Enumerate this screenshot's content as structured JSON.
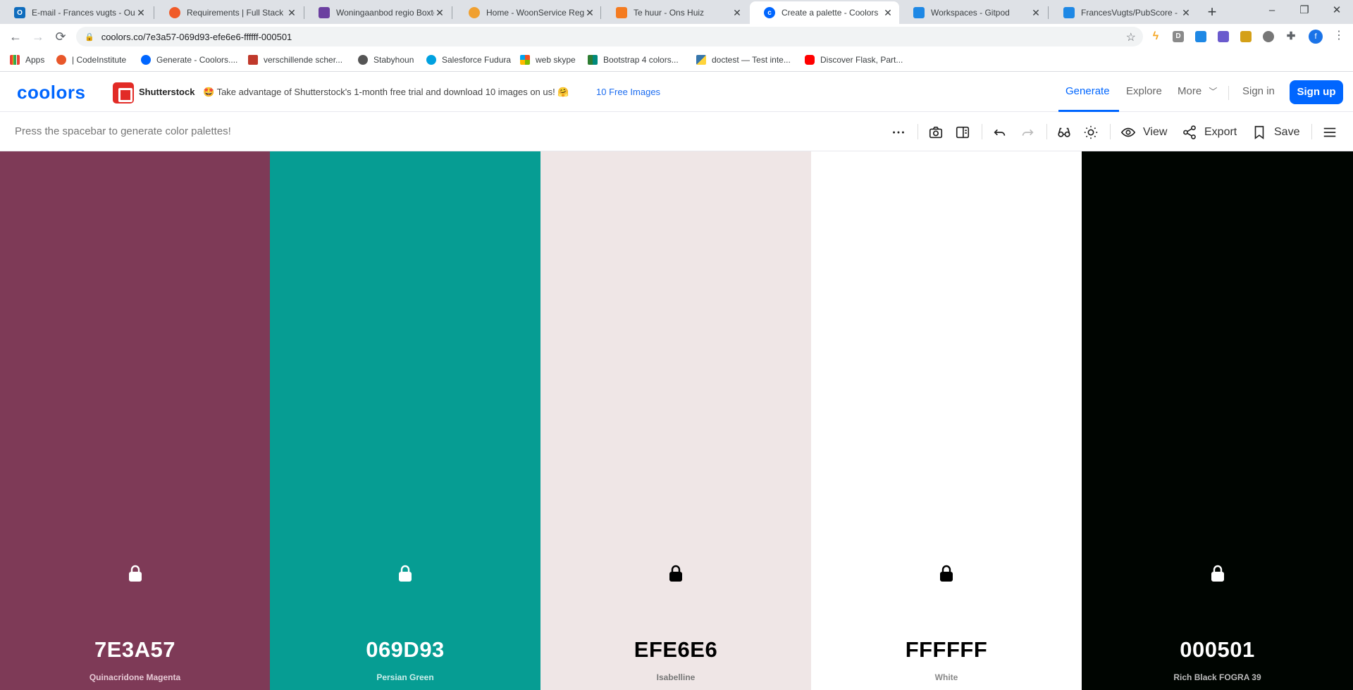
{
  "browser": {
    "tabs": [
      {
        "title": "E-mail - Frances vugts - Outl",
        "icon_color": "#0f6cbd",
        "active": false
      },
      {
        "title": "Requirements | Full Stack Fr",
        "icon_color": "#f05a28",
        "active": false
      },
      {
        "title": "Woningaanbod regio Boxte",
        "icon_color": "#6b3fa0",
        "active": false
      },
      {
        "title": "Home - WoonService Regio",
        "icon_color": "#f0a030",
        "active": false
      },
      {
        "title": "Te huur - Ons Huiz",
        "icon_color": "#f47b20",
        "active": false
      },
      {
        "title": "Create a palette - Coolors",
        "icon_color": "#0066ff",
        "active": true
      },
      {
        "title": "Workspaces - Gitpod",
        "icon_color": "#1e88e5",
        "active": false
      },
      {
        "title": "FrancesVugts/PubScore - m",
        "icon_color": "#1e88e5",
        "active": false
      }
    ],
    "url": "coolors.co/7e3a57-069d93-efe6e6-ffffff-000501",
    "profile_initial": "f",
    "bookmarks": [
      {
        "label": "Apps",
        "icon_color": "#ea4335"
      },
      {
        "label": "| CodeInstitute",
        "icon_color": "#e8572a"
      },
      {
        "label": "Generate - Coolors....",
        "icon_color": "#0066ff"
      },
      {
        "label": "verschillende scher...",
        "icon_color": "#c0392b"
      },
      {
        "label": "Stabyhoun",
        "icon_color": "#555555"
      },
      {
        "label": "Salesforce Fudura",
        "icon_color": "#00a1e0"
      },
      {
        "label": "web skype",
        "icon_color": "#f25022"
      },
      {
        "label": "Bootstrap 4 colors...",
        "icon_color": "#2e7d32"
      },
      {
        "label": "doctest — Test inte...",
        "icon_color": "#3776ab"
      },
      {
        "label": "Discover Flask, Part...",
        "icon_color": "#ff0000"
      }
    ]
  },
  "header": {
    "logo": "coolors",
    "sponsor_name": "Shutterstock",
    "promo_text": "Take advantage of Shutterstock's 1-month free trial and download 10 images on us!",
    "promo_link": "10 Free Images",
    "nav": {
      "generate": "Generate",
      "explore": "Explore",
      "more": "More",
      "sign_in": "Sign in",
      "sign_up": "Sign up"
    }
  },
  "toolbar": {
    "hint": "Press the spacebar to generate color palettes!",
    "view_label": "View",
    "export_label": "Export",
    "save_label": "Save"
  },
  "palette": [
    {
      "hex": "7E3A57",
      "name": "Quinacridone Magenta",
      "color": "#7e3a57",
      "text_color": "#ffffff",
      "name_color": "#e6c9d5"
    },
    {
      "hex": "069D93",
      "name": "Persian Green",
      "color": "#069d93",
      "text_color": "#ffffff",
      "name_color": "#cdeeea"
    },
    {
      "hex": "EFE6E6",
      "name": "Isabelline",
      "color": "#efe6e6",
      "text_color": "#000000",
      "name_color": "#777777"
    },
    {
      "hex": "FFFFFF",
      "name": "White",
      "color": "#ffffff",
      "text_color": "#000000",
      "name_color": "#888888"
    },
    {
      "hex": "000501",
      "name": "Rich Black FOGRA 39",
      "color": "#000501",
      "text_color": "#ffffff",
      "name_color": "#bbbbbb"
    }
  ]
}
